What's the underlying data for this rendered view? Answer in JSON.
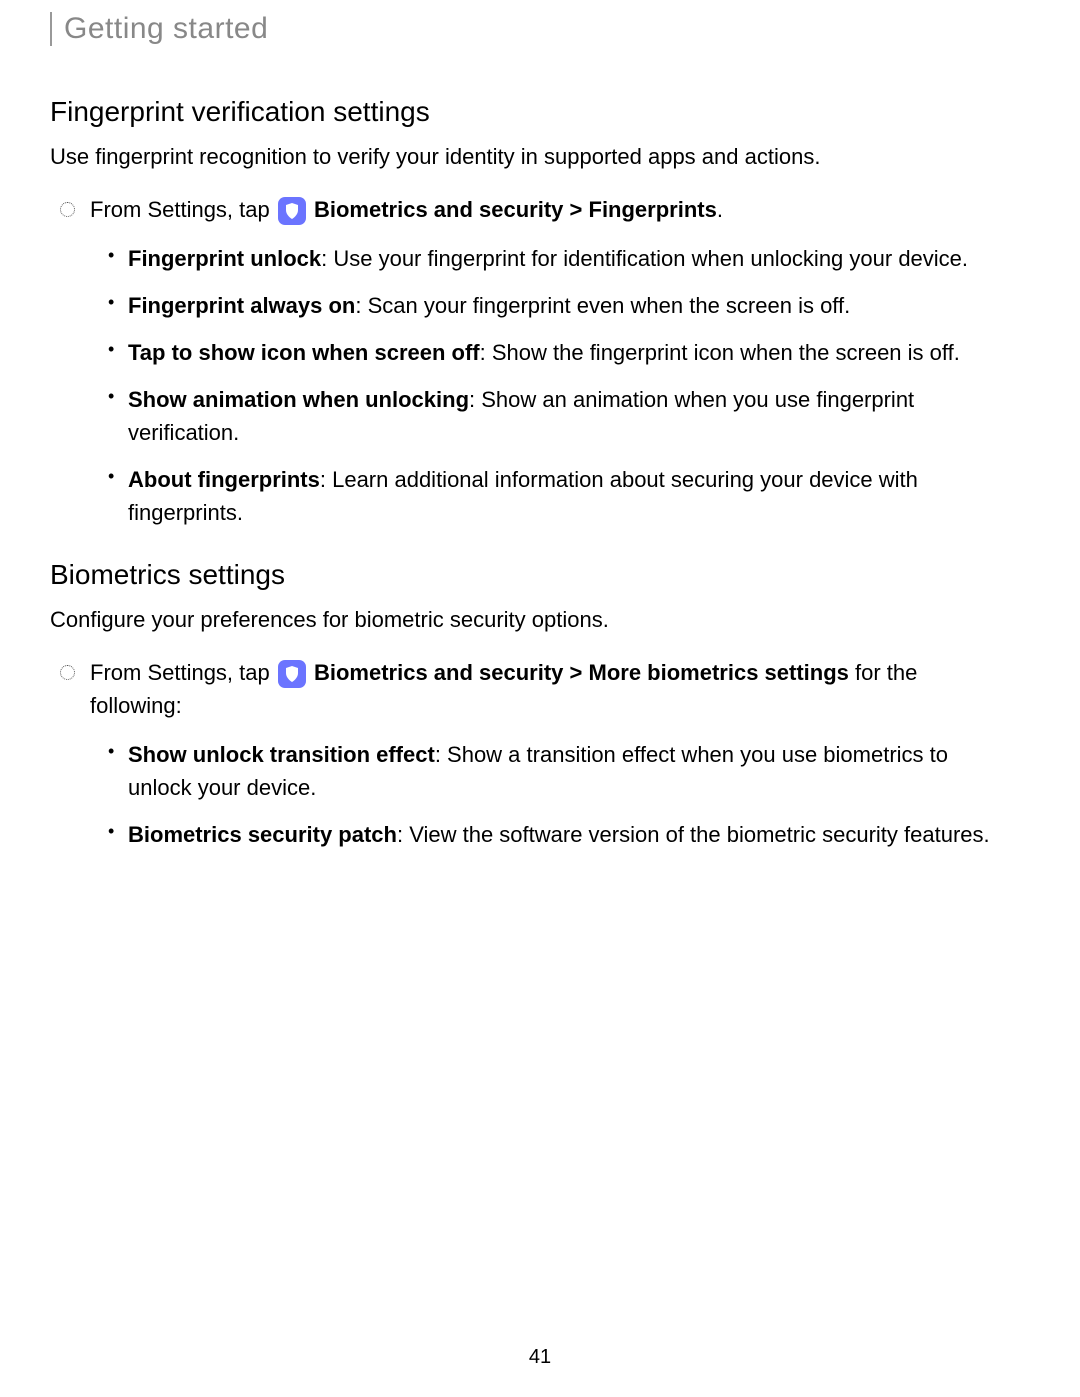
{
  "header": {
    "title": "Getting started"
  },
  "section1": {
    "heading": "Fingerprint verification settings",
    "description": "Use fingerprint recognition to verify your identity in supported apps and actions.",
    "step": {
      "prefix": "From Settings, tap ",
      "path_bold1": "Biometrics and security",
      "sep1": " > ",
      "path_bold2": "Fingerprints",
      "suffix": "."
    },
    "items": [
      {
        "bold": "Fingerprint unlock",
        "text": ": Use your fingerprint for identification when unlocking your device."
      },
      {
        "bold": "Fingerprint always on",
        "text": ": Scan your fingerprint even when the screen is off."
      },
      {
        "bold": "Tap to show icon when screen off",
        "text": ": Show the fingerprint icon when the screen is off."
      },
      {
        "bold": "Show animation when unlocking",
        "text": ": Show an animation when you use fingerprint verification."
      },
      {
        "bold": "About fingerprints",
        "text": ": Learn additional information about securing your device with fingerprints."
      }
    ]
  },
  "section2": {
    "heading": "Biometrics settings",
    "description": "Configure your preferences for biometric security options.",
    "step": {
      "prefix": "From Settings, tap ",
      "path_bold1": "Biometrics and security",
      "sep1": " > ",
      "path_bold2": "More biometrics settings",
      "suffix": " for the following:"
    },
    "items": [
      {
        "bold": "Show unlock transition effect",
        "text": ": Show a transition effect when you use biometrics to unlock your device."
      },
      {
        "bold": "Biometrics security patch",
        "text": ": View the software version of the biometric security features."
      }
    ]
  },
  "pageNumber": "41"
}
